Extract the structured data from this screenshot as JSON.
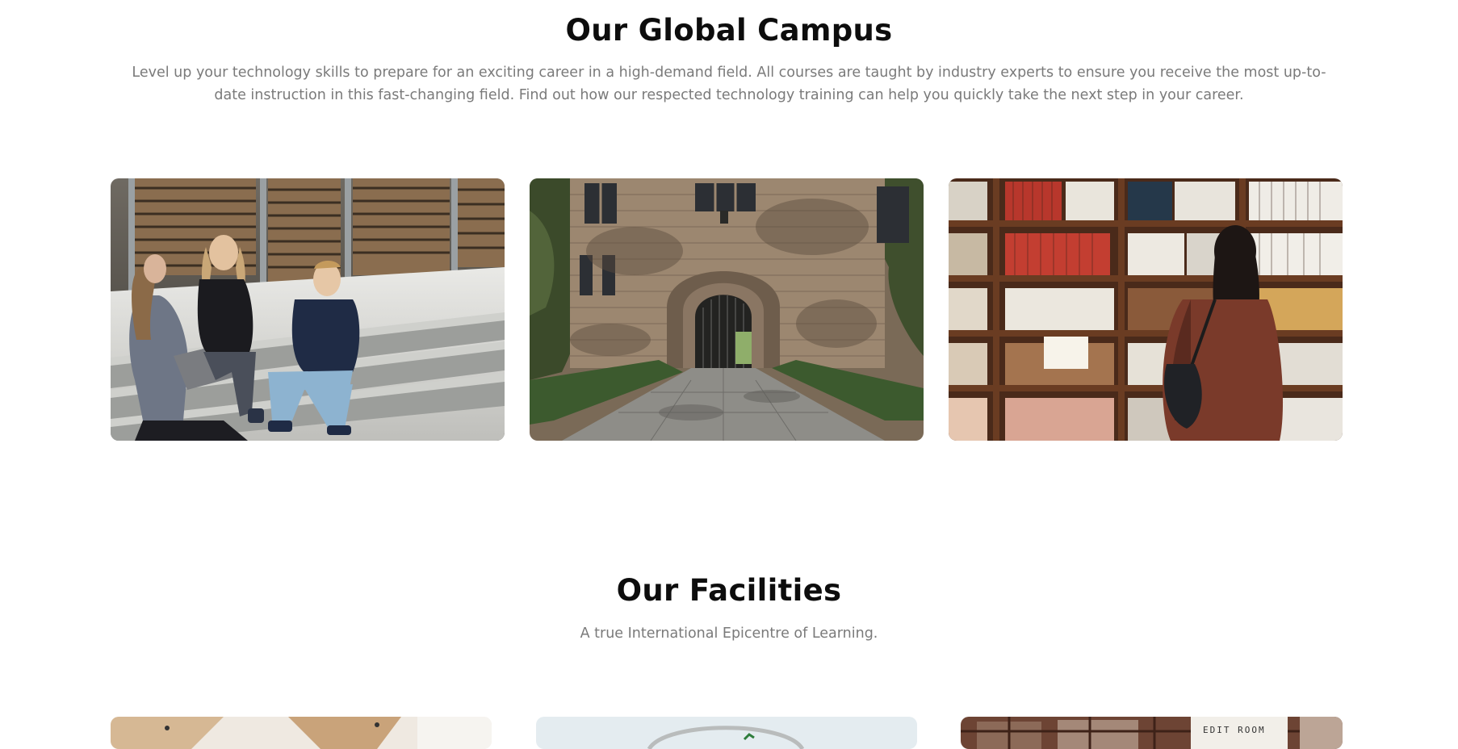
{
  "campus": {
    "title": "Our Global Campus",
    "description": "Level up your technology skills to prepare for an exciting career in a high-demand field. All courses are taught by industry experts to ensure you receive the most up-to-date instruction in this fast-changing field. Find out how our respected technology training can help you quickly take the next step in your career.",
    "images": [
      {
        "label": "students-on-steps"
      },
      {
        "label": "stone-archway"
      },
      {
        "label": "library-bookshelves"
      }
    ]
  },
  "facilities": {
    "title": "Our Facilities",
    "subtitle": "A true International Epicentre of Learning.",
    "edit_room_sign": "EDIT ROOM"
  },
  "colors": {
    "heading": "#0d0d0d",
    "body_text": "#7a7a7a",
    "background": "#ffffff"
  }
}
